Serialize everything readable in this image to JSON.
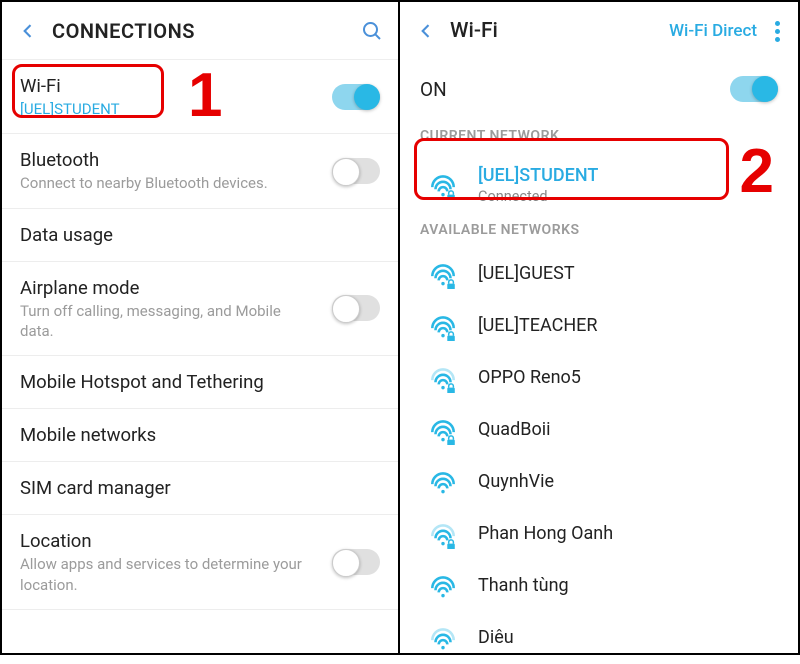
{
  "left": {
    "header": {
      "title": "CONNECTIONS"
    },
    "callout": "1",
    "rows": [
      {
        "title": "Wi-Fi",
        "sub": "[UEL]STUDENT",
        "accent": true,
        "toggle": "on"
      },
      {
        "title": "Bluetooth",
        "sub": "Connect to nearby Bluetooth devices.",
        "toggle": "off"
      },
      {
        "title": "Data usage"
      },
      {
        "title": "Airplane mode",
        "sub": "Turn off calling, messaging, and Mobile data.",
        "toggle": "off"
      },
      {
        "title": "Mobile Hotspot and Tethering"
      },
      {
        "title": "Mobile networks"
      },
      {
        "title": "SIM card manager"
      },
      {
        "title": "Location",
        "sub": "Allow apps and services to determine your location.",
        "toggle": "off"
      }
    ]
  },
  "right": {
    "header": {
      "title": "Wi-Fi",
      "wifiDirect": "Wi-Fi Direct"
    },
    "onLabel": "ON",
    "callout": "2",
    "sections": {
      "current": "CURRENT NETWORK",
      "available": "AVAILABLE NETWORKS"
    },
    "currentNetwork": {
      "name": "[UEL]STUDENT",
      "status": "Connected",
      "locked": true
    },
    "networks": [
      {
        "name": "[UEL]GUEST",
        "locked": true
      },
      {
        "name": "[UEL]TEACHER",
        "locked": true
      },
      {
        "name": "OPPO Reno5",
        "locked": true
      },
      {
        "name": "QuadBoii",
        "locked": true
      },
      {
        "name": "QuynhVie",
        "locked": false
      },
      {
        "name": "Phan Hong Oanh",
        "locked": true
      },
      {
        "name": "Thanh tùng",
        "locked": false
      },
      {
        "name": "Diêu",
        "locked": false
      }
    ]
  }
}
